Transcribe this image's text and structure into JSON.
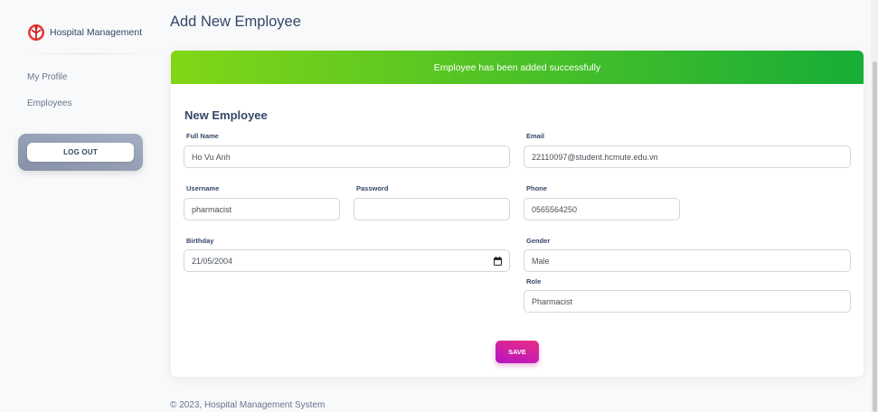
{
  "sidebar": {
    "brand": "Hospital Management",
    "nav": [
      {
        "label": "My Profile"
      },
      {
        "label": "Employees"
      }
    ],
    "logout_label": "LOG OUT"
  },
  "page": {
    "title": "Add New Employee"
  },
  "alert": {
    "message": "Employee has been added successfully",
    "color_start": "#82d616",
    "color_end": "#17ad37"
  },
  "form": {
    "title": "New Employee",
    "full_name": {
      "label": "Full Name",
      "value": "Ho Vu Anh"
    },
    "email": {
      "label": "Email",
      "value": "22110097@student.hcmute.edu.vn"
    },
    "username": {
      "label": "Username",
      "value": "pharmacist"
    },
    "password": {
      "label": "Password",
      "value": ""
    },
    "phone": {
      "label": "Phone",
      "value": "0565564250"
    },
    "birthday": {
      "label": "Birthday",
      "value": "21/05/2004"
    },
    "gender": {
      "label": "Gender",
      "value": "Male"
    },
    "role": {
      "label": "Role",
      "value": "Pharmacist"
    },
    "save_label": "SAVE"
  },
  "footer": {
    "text": "© 2023, Hospital Management System"
  },
  "icons": {
    "brand": "hospital-logo-icon",
    "birthday": "calendar-icon"
  },
  "colors": {
    "text_primary": "#344767",
    "text_muted": "#67748e",
    "save_start": "#ec2d85",
    "save_end": "#b414c4"
  }
}
